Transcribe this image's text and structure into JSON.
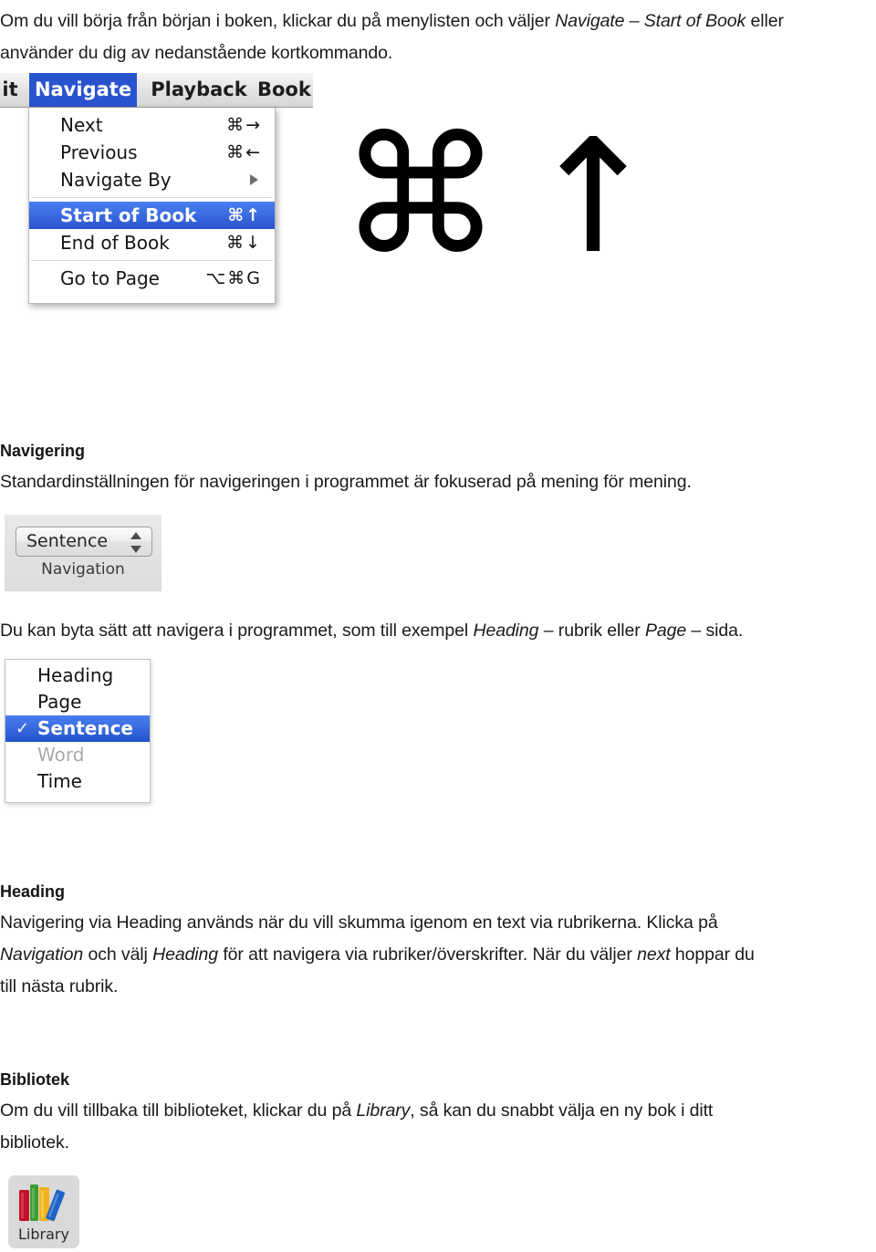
{
  "document": {
    "intro_paragraph": {
      "line1_a": "Om du vill börja från början i boken, klickar du på menylisten och väljer ",
      "line1_em1": "Navigate – Start of Book",
      "line1_b": " eller",
      "line2": "använder du dig av nedanstående kortkommando."
    },
    "section_navigering": {
      "heading": "Navigering",
      "paragraph": "Standardinställningen för navigeringen i programmet är fokuserad på mening för mening.",
      "paragraph2_a": "Du kan byta sätt att navigera i programmet, som till exempel ",
      "paragraph2_em1": "Heading",
      "paragraph2_b": " – rubrik eller ",
      "paragraph2_em2": "Page",
      "paragraph2_c": " – sida."
    },
    "section_heading": {
      "heading": "Heading",
      "line1": "Navigering via Heading används när du vill skumma igenom en text via rubrikerna. Klicka på",
      "line2_em1": "Navigation",
      "line2_a": " och välj ",
      "line2_em2": "Heading",
      "line2_b": " för att navigera via rubriker/överskrifter. När du väljer ",
      "line2_em3": "next",
      "line2_c": " hoppar du",
      "line3": "till nästa rubrik."
    },
    "section_bibliotek": {
      "heading": "Bibliotek",
      "line1_a": "Om du vill tillbaka till biblioteket, klickar du på ",
      "line1_em1": "Library",
      "line1_b": ", så kan du snabbt välja en ny bok i ditt",
      "line2": "bibliotek."
    }
  },
  "menu_screenshot": {
    "menubar": {
      "edit": "it",
      "navigate": "Navigate",
      "playback": "Playback",
      "book": "Book",
      "active_item": "Navigate",
      "highlight_color": "#2a54cf"
    },
    "items": [
      {
        "label": "Next",
        "shortcut": "⌘→",
        "selected": false
      },
      {
        "label": "Previous",
        "shortcut": "⌘←",
        "selected": false
      },
      {
        "label": "Navigate By",
        "shortcut": "",
        "submenu": true,
        "selected": false
      },
      {
        "label": "Start of Book",
        "shortcut": "⌘↑",
        "selected": true
      },
      {
        "label": "End of Book",
        "shortcut": "⌘↓",
        "selected": false
      },
      {
        "label": "Go to Page",
        "shortcut": "⌥⌘G",
        "selected": false
      }
    ]
  },
  "shortcut_glyphs": {
    "command": "⌘",
    "up_arrow": "↑"
  },
  "sentence_popup": {
    "value": "Sentence",
    "caption": "Navigation"
  },
  "navigate_by_list": {
    "items": [
      {
        "label": "Heading",
        "checked": false,
        "selected": false,
        "disabled": false
      },
      {
        "label": "Page",
        "checked": false,
        "selected": false,
        "disabled": false
      },
      {
        "label": "Sentence",
        "checked": true,
        "check_glyph": "✓",
        "selected": true,
        "disabled": false
      },
      {
        "label": "Word",
        "checked": false,
        "selected": false,
        "disabled": true
      },
      {
        "label": "Time",
        "checked": false,
        "selected": false,
        "disabled": false
      }
    ],
    "highlight_color": "#2453cd"
  },
  "library_button": {
    "caption": "Library",
    "book_colors": [
      "#c1122a",
      "#3f9c35",
      "#efb31b",
      "#1f63c4"
    ]
  }
}
